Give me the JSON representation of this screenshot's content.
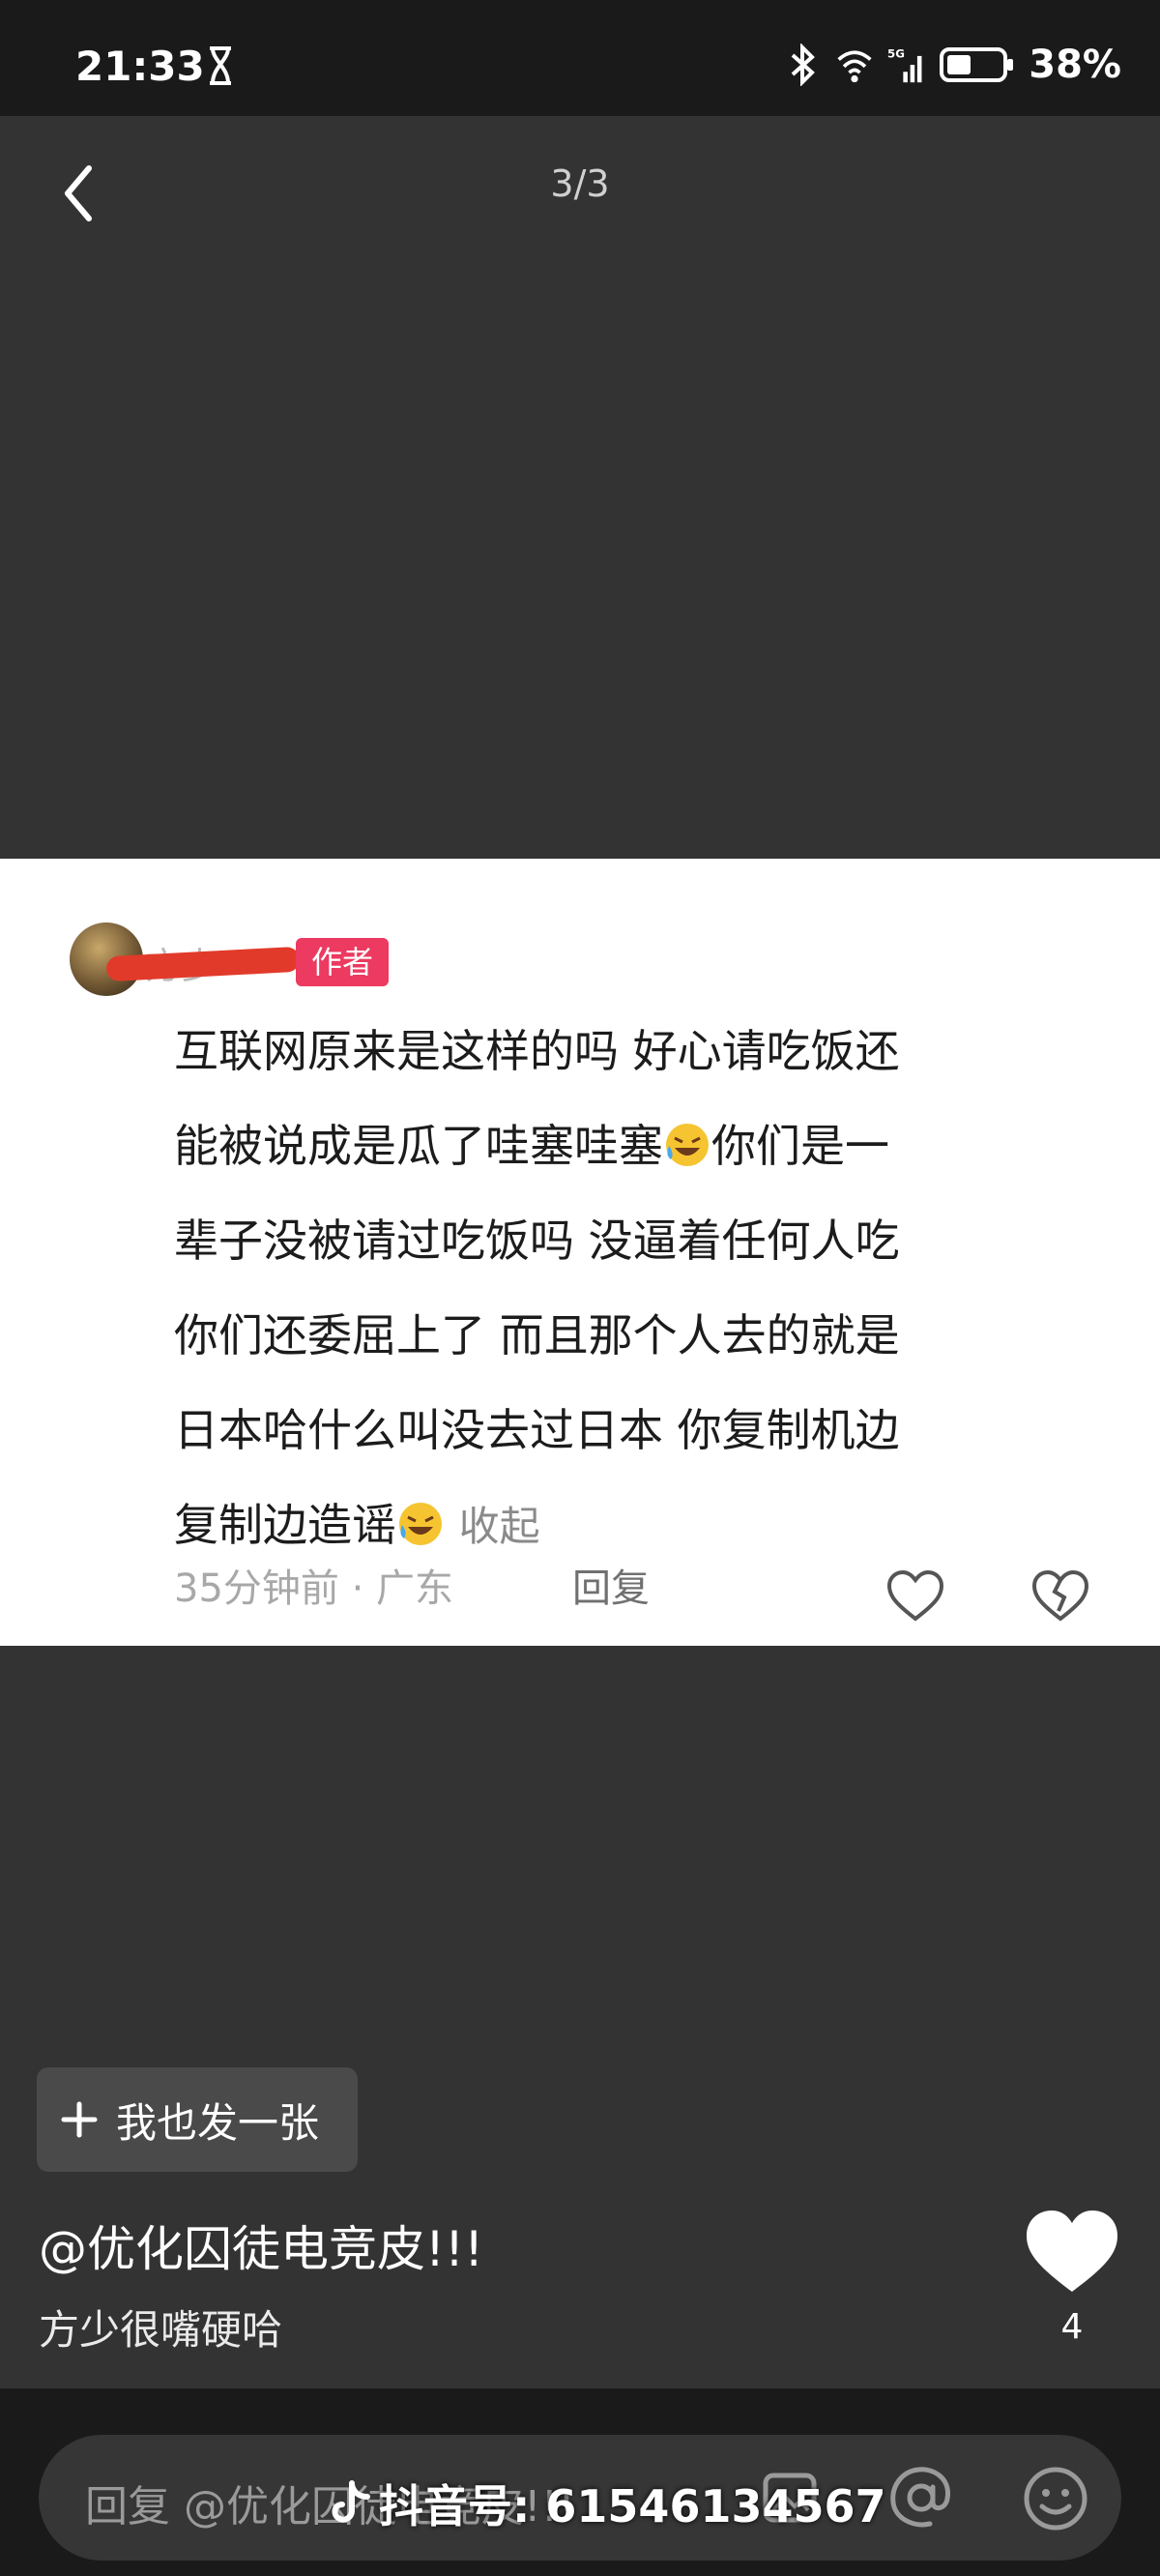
{
  "status_bar": {
    "time": "21:33",
    "network": "5G",
    "battery_pct": "38%",
    "icons": [
      "hourglass-icon",
      "bluetooth-icon",
      "wifi-icon",
      "signal-icon",
      "battery-icon"
    ]
  },
  "header": {
    "page_counter": "3/3",
    "back_icon": "chevron-left-icon"
  },
  "comment_card": {
    "author_name": "方少",
    "author_badge": "作者",
    "text_lines": [
      "互联网原来是这样的吗 好心请吃饭还",
      "能被说成是瓜了哇塞哇塞",
      "你们是一",
      "辈子没被请过吃饭吗 没逼着任何人吃",
      "你们还委屈上了 而且那个人去的就是",
      "日本哈什么叫没去过日本 你复制机边",
      "复制边造谣"
    ],
    "collapse_label": "收起",
    "time_location": "35分钟前 · 广东",
    "reply_label": "回复",
    "emoji_icon": "laughing-crying-emoji-icon"
  },
  "bottom": {
    "post_button_label": "我也发一张",
    "caption_title": "@优化囚徒电竞皮!!!",
    "caption_sub": "方少很嘴硬哈",
    "like_count": "4",
    "reply_placeholder": "回复 @优化囚徒电竞皮!!!",
    "watermark_text": "抖音号: 61546134567"
  },
  "colors": {
    "background": "#333333",
    "status_bar": "#1a1a1a",
    "author_badge": "#ec3a60",
    "redaction": "#e23a2a"
  }
}
